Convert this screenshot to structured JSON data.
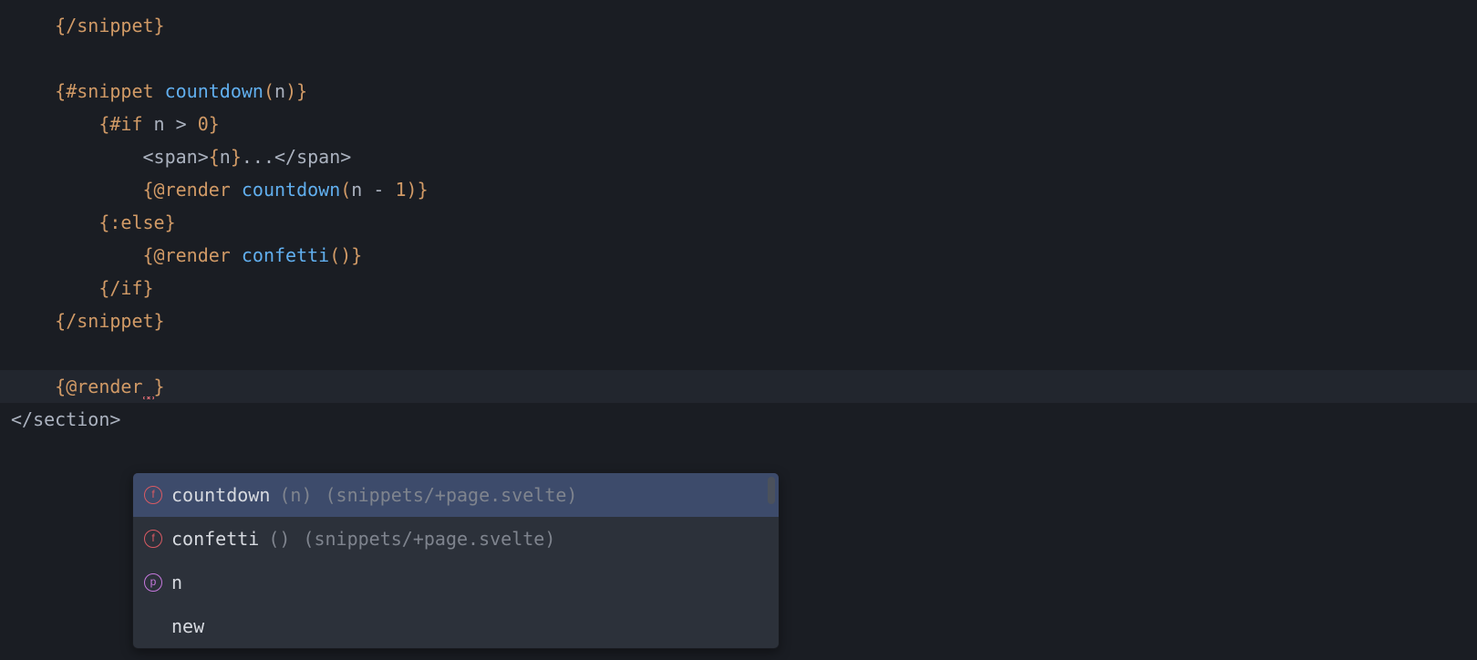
{
  "code": {
    "l1": "{/snippet}",
    "l3_open": "{#snippet",
    "l3_func": " countdown",
    "l3_paren_open": "(",
    "l3_param": "n",
    "l3_paren_close": ")",
    "l3_close": "}",
    "l4_open": "{#if",
    "l4_cond": " n > ",
    "l4_num": "0",
    "l4_close": "}",
    "l5_a": "<span>",
    "l5_b": "{",
    "l5_c": "n",
    "l5_d": "}",
    "l5_e": "...",
    "l5_f": "</span>",
    "l6_open": "{@render",
    "l6_func": " countdown",
    "l6_paren_open": "(",
    "l6_arg1": "n",
    "l6_op": " - ",
    "l6_arg2": "1",
    "l6_paren_close": ")",
    "l6_close": "}",
    "l7": "{:else}",
    "l8_open": "{@render",
    "l8_func": " confetti",
    "l8_paren": "()",
    "l8_close": "}",
    "l9": "{/if}",
    "l10": "{/snippet}",
    "l12_open": "{@render",
    "l12_space": " ",
    "l12_close": "}",
    "l13": "</section>"
  },
  "autocomplete": {
    "items": [
      {
        "icon": "f",
        "iconType": "func",
        "label": "countdown",
        "sig": "(n)",
        "path": "(snippets/+page.svelte)",
        "selected": true
      },
      {
        "icon": "f",
        "iconType": "func",
        "label": "confetti",
        "sig": "()",
        "path": "(snippets/+page.svelte)",
        "selected": false
      },
      {
        "icon": "p",
        "iconType": "prop",
        "label": "n",
        "sig": "",
        "path": "",
        "selected": false
      },
      {
        "icon": "",
        "iconType": "none",
        "label": "new",
        "sig": "",
        "path": "",
        "selected": false
      }
    ]
  }
}
